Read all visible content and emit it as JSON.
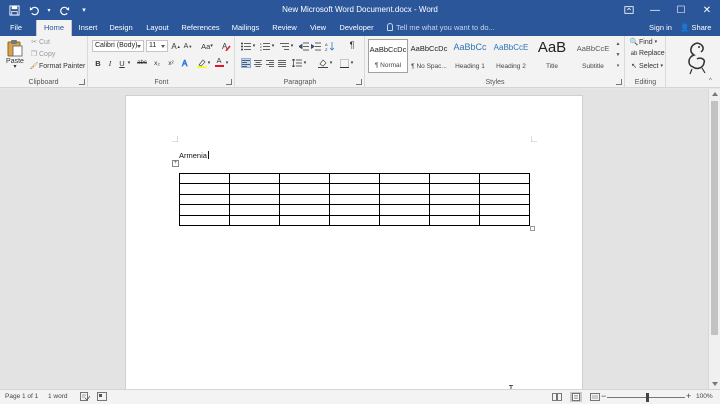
{
  "window": {
    "title": "New Microsoft Word Document.docx - Word",
    "minimize": "—",
    "maximize": "☐",
    "close": "✕"
  },
  "tabs": [
    {
      "label": "File"
    },
    {
      "label": "Home"
    },
    {
      "label": "Insert"
    },
    {
      "label": "Design"
    },
    {
      "label": "Layout"
    },
    {
      "label": "References"
    },
    {
      "label": "Mailings"
    },
    {
      "label": "Review"
    },
    {
      "label": "View"
    },
    {
      "label": "Developer"
    }
  ],
  "tell_me": "Tell me what you want to do...",
  "account": {
    "sign_in": "Sign in",
    "share": "Share"
  },
  "clipboard": {
    "group_label": "Clipboard",
    "paste": "Paste",
    "cut": "Cut",
    "copy": "Copy",
    "format_painter": "Format Painter"
  },
  "font": {
    "group_label": "Font",
    "font_name": "Calibri (Body)",
    "font_size": "11",
    "grow": "A",
    "shrink": "A",
    "case": "Aa",
    "bold": "B",
    "italic": "I",
    "underline": "U",
    "strike": "abc",
    "subscript": "x₂",
    "superscript": "x²",
    "font_color": "A"
  },
  "paragraph": {
    "group_label": "Paragraph",
    "pilcrow": "¶"
  },
  "styles": {
    "group_label": "Styles",
    "items": [
      {
        "sample": "AaBbCcDc",
        "name": "¶ Normal"
      },
      {
        "sample": "AaBbCcDc",
        "name": "¶ No Spac..."
      },
      {
        "sample": "AaBbCc",
        "name": "Heading 1"
      },
      {
        "sample": "AaBbCcE",
        "name": "Heading 2"
      },
      {
        "sample": "AaB",
        "name": "Title"
      },
      {
        "sample": "AaBbCcE",
        "name": "Subtitle"
      }
    ]
  },
  "editing": {
    "group_label": "Editing",
    "find": "Find",
    "replace": "Replace",
    "select": "Select"
  },
  "document": {
    "text": "Armenia",
    "table": {
      "rows": 5,
      "cols": 7
    }
  },
  "status": {
    "page": "Page 1 of 1",
    "words": "1 word",
    "zoom": "100%",
    "zoom_out": "−",
    "zoom_in": "+"
  },
  "colors": {
    "brand": "#2b579a",
    "highlight": "#ffff00",
    "font_color": "#e81123"
  }
}
